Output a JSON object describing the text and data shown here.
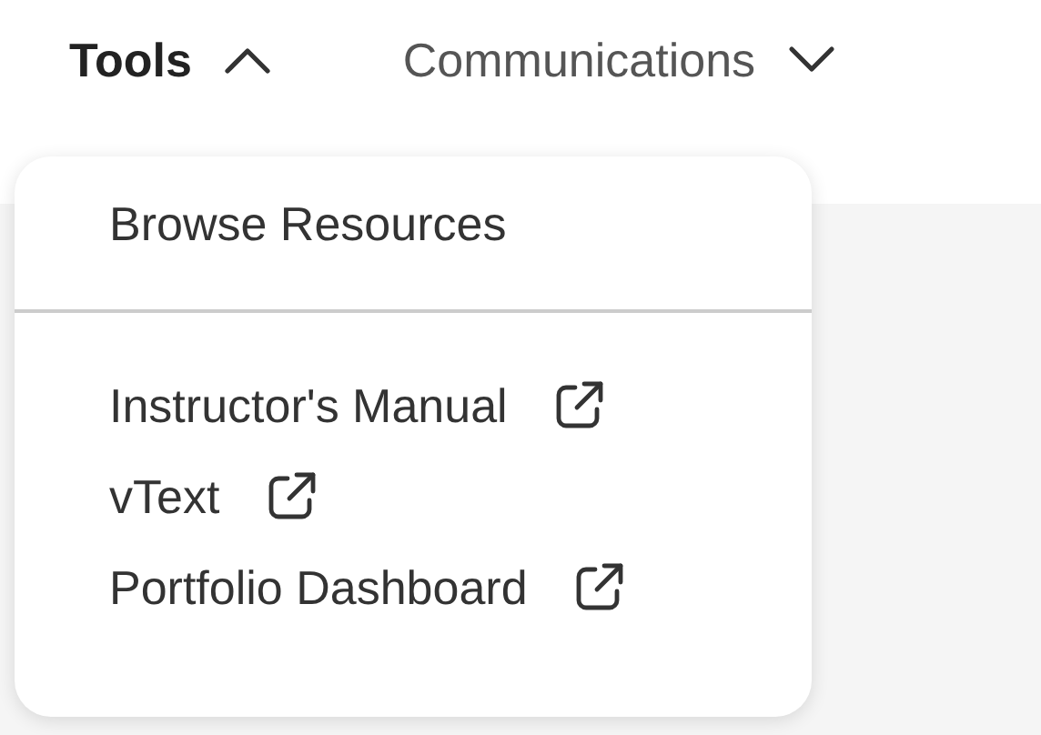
{
  "nav": [
    {
      "label": "Tools",
      "expanded": true,
      "active": true
    },
    {
      "label": "Communications",
      "expanded": false,
      "active": false
    }
  ],
  "menu": {
    "items": [
      {
        "label": "Browse Resources",
        "kind": "link"
      },
      {
        "kind": "divider"
      },
      {
        "label": "Instructor's Manual",
        "kind": "external"
      },
      {
        "label": "vText",
        "kind": "external"
      },
      {
        "label": "Portfolio Dashboard",
        "kind": "external"
      }
    ]
  }
}
